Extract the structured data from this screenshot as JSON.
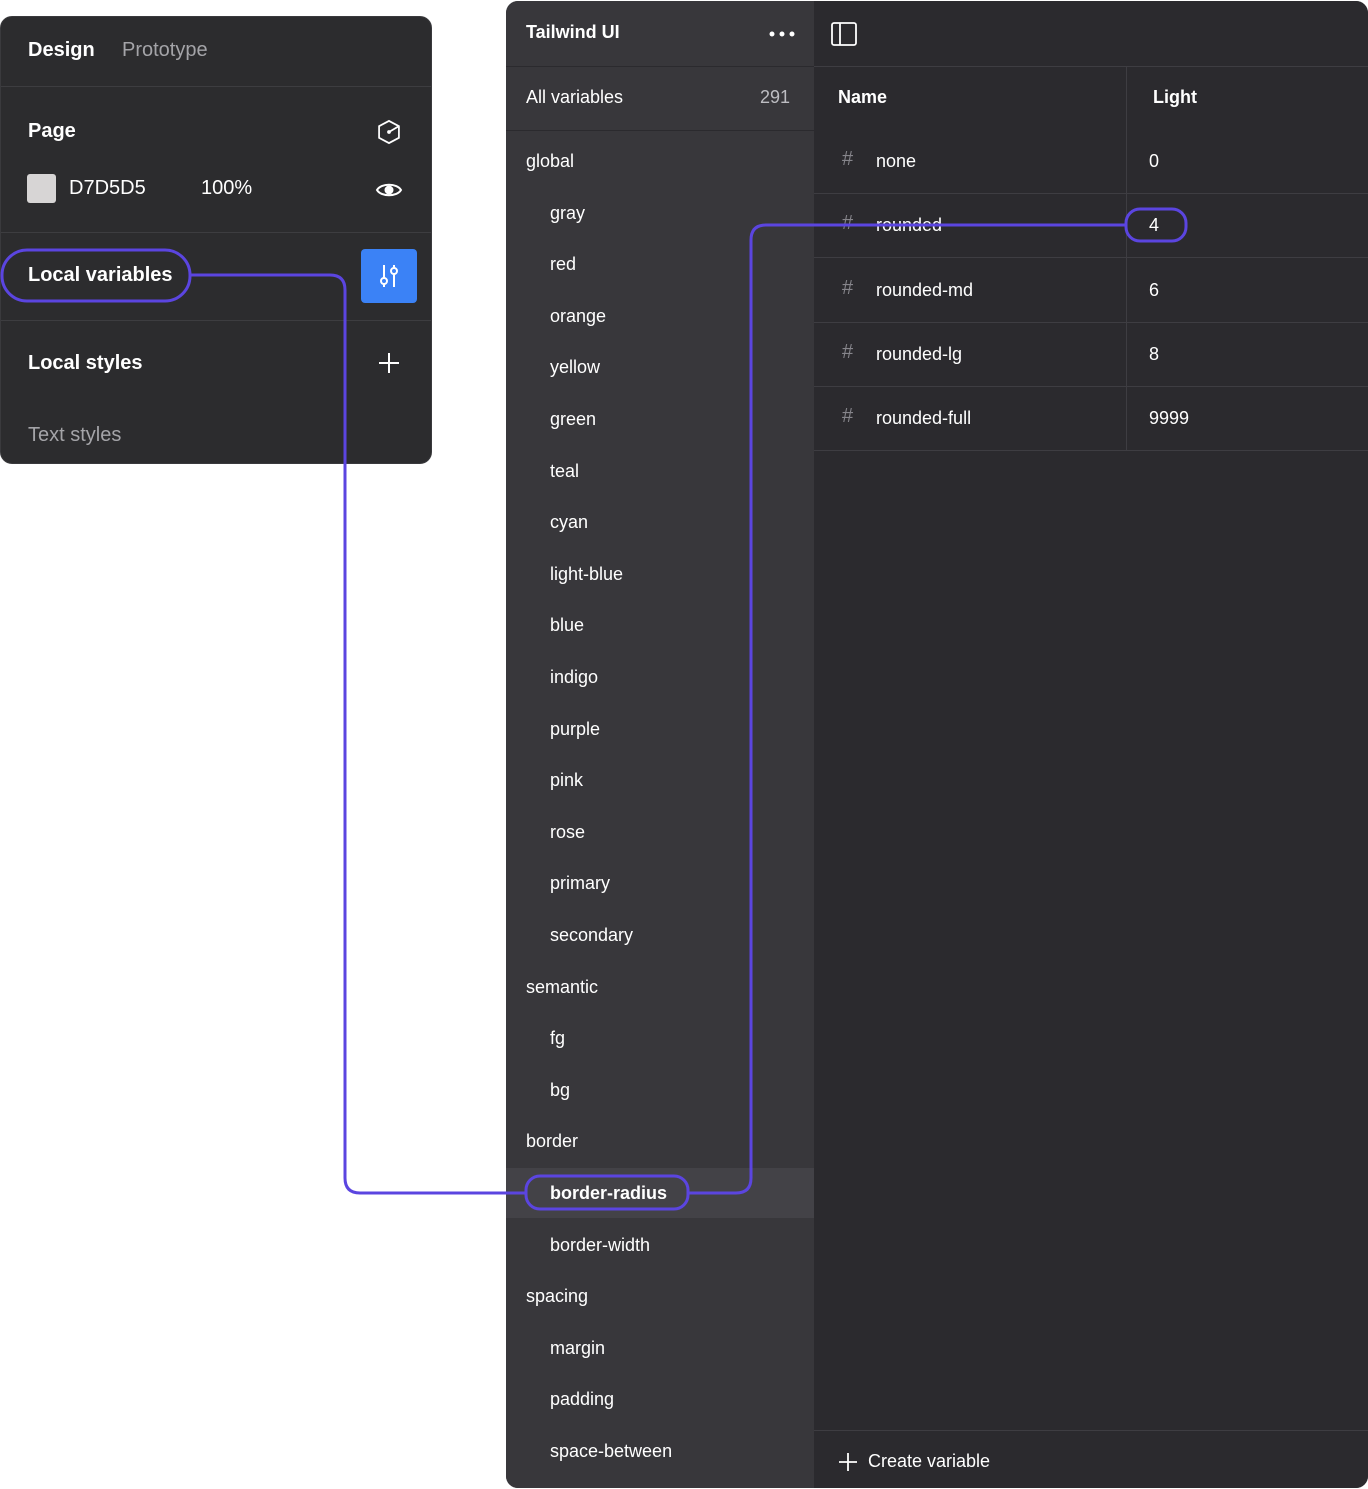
{
  "design_panel": {
    "tabs": [
      {
        "label": "Design",
        "active": true
      },
      {
        "label": "Prototype",
        "active": false
      }
    ],
    "page": {
      "title": "Page",
      "background_hex": "D7D5D5",
      "background_color": "#D7D5D5",
      "opacity": "100%"
    },
    "local_variables_label": "Local variables",
    "local_styles_label": "Local styles",
    "text_styles_label": "Text styles",
    "icons": [
      "cube-icon",
      "eye-icon",
      "sliders-icon",
      "plus-icon"
    ]
  },
  "variables_modal": {
    "library_name": "Tailwind UI",
    "all_variables": {
      "label": "All variables",
      "count": "291"
    },
    "collections": [
      {
        "label": "global",
        "level": 0
      },
      {
        "label": "gray",
        "level": 1
      },
      {
        "label": "red",
        "level": 1
      },
      {
        "label": "orange",
        "level": 1
      },
      {
        "label": "yellow",
        "level": 1
      },
      {
        "label": "green",
        "level": 1
      },
      {
        "label": "teal",
        "level": 1
      },
      {
        "label": "cyan",
        "level": 1
      },
      {
        "label": "light-blue",
        "level": 1
      },
      {
        "label": "blue",
        "level": 1
      },
      {
        "label": "indigo",
        "level": 1
      },
      {
        "label": "purple",
        "level": 1
      },
      {
        "label": "pink",
        "level": 1
      },
      {
        "label": "rose",
        "level": 1
      },
      {
        "label": "primary",
        "level": 1
      },
      {
        "label": "secondary",
        "level": 1
      },
      {
        "label": "semantic",
        "level": 0
      },
      {
        "label": "fg",
        "level": 1
      },
      {
        "label": "bg",
        "level": 1
      },
      {
        "label": "border",
        "level": 0
      },
      {
        "label": "border-radius",
        "level": 1,
        "selected": true
      },
      {
        "label": "border-width",
        "level": 1
      },
      {
        "label": "spacing",
        "level": 0
      },
      {
        "label": "margin",
        "level": 1
      },
      {
        "label": "padding",
        "level": 1
      },
      {
        "label": "space-between",
        "level": 1
      }
    ],
    "table": {
      "columns": [
        "Name",
        "Light"
      ],
      "rows": [
        {
          "name": "none",
          "value": "0"
        },
        {
          "name": "rounded",
          "value": "4"
        },
        {
          "name": "rounded-md",
          "value": "6"
        },
        {
          "name": "rounded-lg",
          "value": "8"
        },
        {
          "name": "rounded-full",
          "value": "9999"
        }
      ]
    },
    "create_variable_label": "Create variable"
  },
  "colors": {
    "panel_bg": "#2c2c2e",
    "sidebar_bg": "#38373b",
    "accent_blue": "#3b82f6",
    "annotation": "#5b45e0"
  }
}
